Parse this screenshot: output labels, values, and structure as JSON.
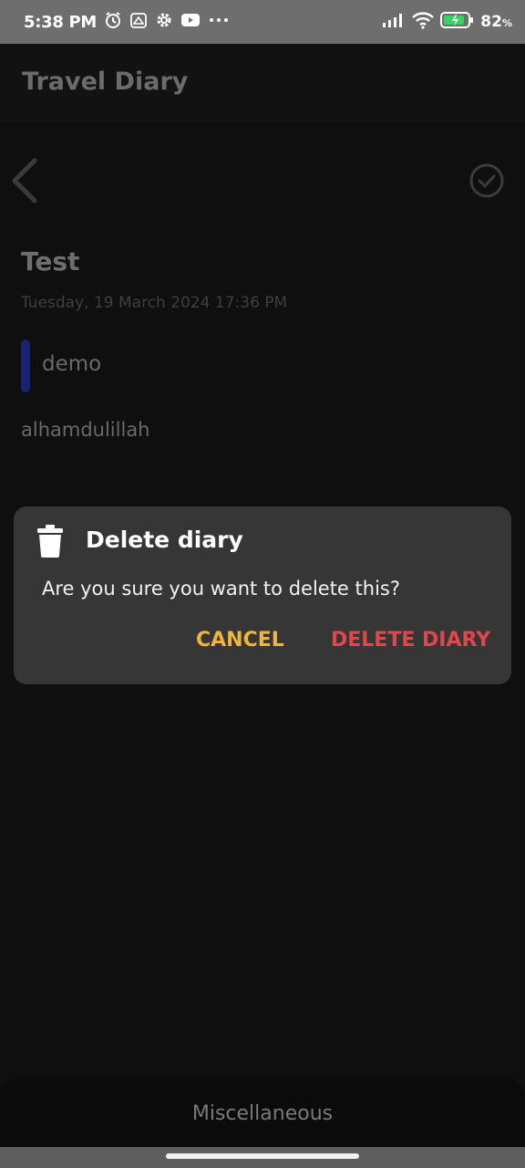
{
  "status_bar": {
    "time": "5:38 PM",
    "icons_left": [
      "alarm-icon",
      "bag-icon",
      "settings-icon",
      "youtube-icon",
      "more-dots-icon"
    ],
    "icons_right": [
      "signal-icon",
      "wifi-icon",
      "battery-icon"
    ],
    "battery_percent": "82",
    "battery_unit": "%"
  },
  "app_bar": {
    "title": "Travel Diary"
  },
  "entry": {
    "title": "Test",
    "date": "Tuesday, 19 March 2024 17:36 PM",
    "tag": "demo",
    "tag_color": "#1a2370",
    "body": "alhamdulillah"
  },
  "dialog": {
    "icon": "trash-icon",
    "title": "Delete diary",
    "message": "Are you sure you want to delete this?",
    "cancel_label": "CANCEL",
    "delete_label": "DELETE DIARY",
    "cancel_color": "#f0b43c",
    "delete_color": "#e0474c"
  },
  "bottom_bar": {
    "label": "Miscellaneous"
  }
}
